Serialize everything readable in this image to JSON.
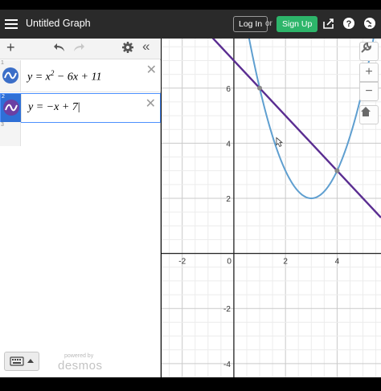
{
  "app": {
    "title": "Untitled Graph",
    "login_label": "Log In",
    "or_label": "or",
    "signup_label": "Sign Up"
  },
  "toolbar": {
    "add_icon": "plus-icon",
    "undo_icon": "undo-icon",
    "redo_icon": "redo-icon",
    "settings_icon": "gear-icon",
    "collapse_icon": "double-chevron-left-icon"
  },
  "expressions": [
    {
      "index": "1",
      "latex": "y = x^2 − 6x + 11",
      "color": "#5f9fd0",
      "active": false
    },
    {
      "index": "2",
      "latex": "y = −x + 7",
      "color": "#5a2d91",
      "active": true
    }
  ],
  "empty_row_index": "3",
  "footer": {
    "powered_label": "powered by",
    "brand_label": "desmos"
  },
  "graph": {
    "x_range": [
      -2.8,
      5.7
    ],
    "y_range": [
      -4.5,
      7.8
    ],
    "x_tick_labels": [
      "-2",
      "0",
      "2",
      "4"
    ],
    "y_tick_labels": [
      "6",
      "4",
      "2",
      "-2",
      "-4"
    ],
    "curve_color": "#5f9fd0",
    "line_color": "#5a2d91",
    "intersections": [
      [
        1,
        6
      ],
      [
        4,
        3
      ]
    ]
  },
  "graph_controls": {
    "wrench": "wrench-icon",
    "zoom_in": "+",
    "zoom_out": "−",
    "home": "home-icon"
  }
}
